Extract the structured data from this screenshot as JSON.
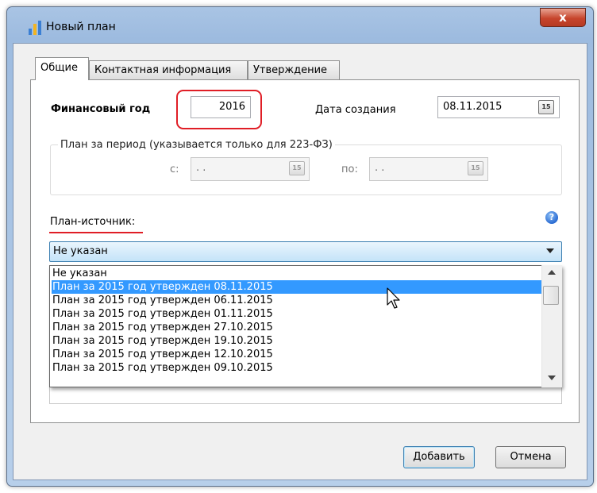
{
  "window": {
    "title": "Новый план",
    "close_glyph": "x"
  },
  "tabs": [
    {
      "label": "Общие",
      "active": true
    },
    {
      "label": "Контактная информация",
      "active": false
    },
    {
      "label": "Утверждение",
      "active": false
    }
  ],
  "form": {
    "fiscal_year_label": "Финансовый год",
    "fiscal_year_value": "2016",
    "created_date_label": "Дата создания",
    "created_date_value": "08.11.2015",
    "calendar_glyph": "15",
    "period_group_label": "План за период (указывается только для 223-ФЗ)",
    "period_from_label": "с:",
    "period_from_value": " .  .",
    "period_to_label": "по:",
    "period_to_value": " .  .",
    "source_plan_label": "План-источник:",
    "help_glyph": "?",
    "source_plan_selected": "Не указан"
  },
  "dropdown_items": [
    "Не указан",
    "План за 2015 год утвержден 08.11.2015",
    "План за 2015 год утвержден 06.11.2015",
    "План за 2015 год утвержден 01.11.2015",
    "План за 2015 год утвержден 27.10.2015",
    "План за 2015 год утвержден 19.10.2015",
    "План за 2015 год утвержден 12.10.2015",
    "План за 2015 год утвержден 09.10.2015"
  ],
  "dropdown_highlighted_index": 1,
  "buttons": {
    "add": "Добавить",
    "cancel": "Отмена"
  },
  "colors": {
    "highlight": "#3399ff",
    "annotation_red": "#e01e26",
    "close_red": "#c7452d"
  },
  "icons": {
    "app": "bar-chart-icon",
    "help": "help-icon",
    "calendar": "calendar-icon",
    "cursor": "mouse-pointer-icon"
  }
}
